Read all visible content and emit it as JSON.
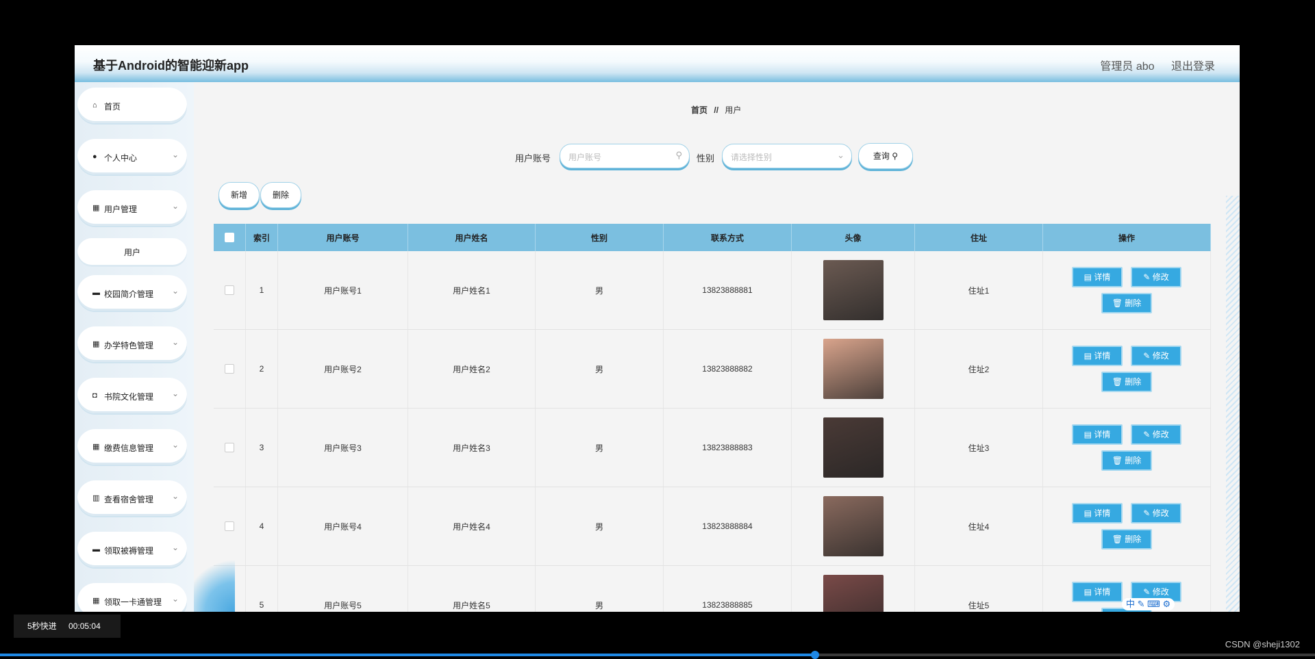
{
  "header": {
    "app_title": "基于Android的智能迎新app",
    "user_label": "管理员 abo",
    "logout_label": "退出登录"
  },
  "sidebar": {
    "items": [
      {
        "label": "首页",
        "icon": "home-icon",
        "expandable": false
      },
      {
        "label": "个人中心",
        "icon": "user-icon",
        "expandable": true
      },
      {
        "label": "用户管理",
        "icon": "grid-icon",
        "expandable": true
      },
      {
        "label": "用户",
        "icon": "",
        "expandable": false,
        "sub": true
      },
      {
        "label": "校园简介管理",
        "icon": "ticket-icon",
        "expandable": true
      },
      {
        "label": "办学特色管理",
        "icon": "grid-icon",
        "expandable": true
      },
      {
        "label": "书院文化管理",
        "icon": "camera-icon",
        "expandable": true
      },
      {
        "label": "缴费信息管理",
        "icon": "grid-icon",
        "expandable": true
      },
      {
        "label": "查看宿舍管理",
        "icon": "books-icon",
        "expandable": true
      },
      {
        "label": "领取被褥管理",
        "icon": "chat-icon",
        "expandable": true
      },
      {
        "label": "领取一卡通管理",
        "icon": "grid-icon",
        "expandable": true
      }
    ]
  },
  "breadcrumb": {
    "home": "首页",
    "sep": "//",
    "current": "用户"
  },
  "search": {
    "account_label": "用户账号",
    "account_placeholder": "用户账号",
    "gender_label": "性别",
    "gender_placeholder": "请选择性别",
    "query_label": "查询"
  },
  "toolbar": {
    "add_label": "新增",
    "delete_label": "删除"
  },
  "table": {
    "headers": [
      "索引",
      "用户账号",
      "用户姓名",
      "性别",
      "联系方式",
      "头像",
      "住址",
      "操作"
    ],
    "rows": [
      {
        "index": "1",
        "account": "用户账号1",
        "name": "用户姓名1",
        "gender": "男",
        "phone": "13823888881",
        "address": "住址1",
        "avatar_color": "#6b5a52"
      },
      {
        "index": "2",
        "account": "用户账号2",
        "name": "用户姓名2",
        "gender": "男",
        "phone": "13823888882",
        "address": "住址2",
        "avatar_color": "#d9a48c"
      },
      {
        "index": "3",
        "account": "用户账号3",
        "name": "用户姓名3",
        "gender": "男",
        "phone": "13823888883",
        "address": "住址3",
        "avatar_color": "#4a3a36"
      },
      {
        "index": "4",
        "account": "用户账号4",
        "name": "用户姓名4",
        "gender": "男",
        "phone": "13823888884",
        "address": "住址4",
        "avatar_color": "#8a6a5e"
      },
      {
        "index": "5",
        "account": "用户账号5",
        "name": "用户姓名5",
        "gender": "男",
        "phone": "13823888885",
        "address": "住址5",
        "avatar_color": "#7a4a48"
      }
    ],
    "actions": {
      "detail": "详情",
      "edit": "修改",
      "delete": "删除"
    }
  },
  "player": {
    "speed_label": "5秒快进",
    "time": "00:05:04",
    "progress": 0.62
  },
  "watermark": "CSDN @sheji1302",
  "ime": "中"
}
